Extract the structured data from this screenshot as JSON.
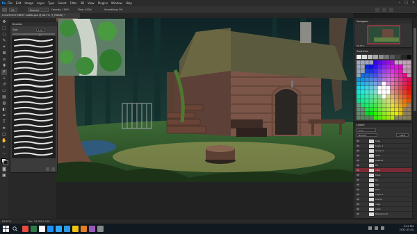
{
  "app": {
    "logo": "Ps",
    "menu": [
      "File",
      "Edit",
      "Image",
      "Layer",
      "Type",
      "Select",
      "Filter",
      "3D",
      "View",
      "Plugins",
      "Window",
      "Help"
    ],
    "window_controls": [
      "–",
      "□",
      "✕"
    ]
  },
  "options": {
    "tool_size": "50",
    "brush_mode": "Normal",
    "opacity_label": "Opacity: 100%",
    "flow_label": "Flow: 100%",
    "smoothing_label": "Smoothing: 0%"
  },
  "document": {
    "tab_title": "LOCATION FOREST CABIN.psd @ 66.7% (T_RGB/8) *"
  },
  "brushes_panel": {
    "title": "Brushes",
    "size_label": "Size:",
    "size_value": "115 px",
    "stroke_count": 21
  },
  "navigator": {
    "title": "Navigator",
    "zoom": "66.67%"
  },
  "swatches": {
    "title": "Swatches"
  },
  "layers": {
    "title": "Layers",
    "search_placeholder": "Kind",
    "blend_mode": "Normal",
    "opacity": "100%",
    "rows": [
      {
        "name": "base",
        "selected": false
      },
      {
        "name": "Layer 1",
        "selected": false
      },
      {
        "name": "Group 1",
        "selected": false
      },
      {
        "name": "lines",
        "selected": false
      },
      {
        "name": "shadow",
        "selected": false
      },
      {
        "name": "fill",
        "selected": false
      },
      {
        "name": "color",
        "selected": true
      },
      {
        "name": "trees",
        "selected": false
      },
      {
        "name": "bg",
        "selected": false
      },
      {
        "name": "sky",
        "selected": false
      },
      {
        "name": "floor",
        "selected": false
      },
      {
        "name": "Layer 2",
        "selected": false
      },
      {
        "name": "stump",
        "selected": false
      },
      {
        "name": "cage",
        "selected": false
      },
      {
        "name": "cabin",
        "selected": false
      },
      {
        "name": "Background",
        "selected": false
      }
    ]
  },
  "status": {
    "zoom": "66.67%",
    "doc_size": "Doc: 34.9M/1.08G"
  },
  "taskbar": {
    "time": "3:54 PM",
    "date": "2022-03-04",
    "icon_colors": [
      "#e74c3c",
      "#2d7d46",
      "#ffffff",
      "#1e90ff",
      "#31a8ff",
      "#2c9be6",
      "#f1c40f",
      "#e67e22",
      "#9b59b6",
      "#888888"
    ]
  },
  "colors": {
    "accent": "#31a8ff",
    "swatch_palette": [
      "#f2f2f2",
      "#d9d9d9",
      "#bfbfbf",
      "#a6a6a6",
      "#8c8c8c",
      "#737373",
      "#595959",
      "#404040",
      "#262626",
      "#0d0d0d"
    ]
  }
}
